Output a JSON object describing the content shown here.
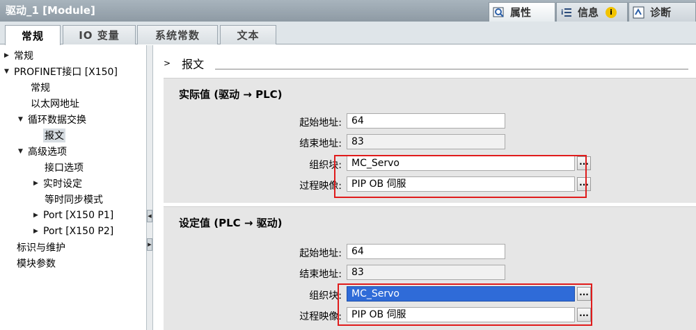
{
  "window": {
    "title": "驱动_1 [Module]"
  },
  "right_tabs": [
    {
      "label": "属性",
      "icon": "properties-icon"
    },
    {
      "label": "信息",
      "icon": "info-icon"
    },
    {
      "label": "诊断",
      "icon": "diagnostics-icon"
    }
  ],
  "tabs": [
    "常规",
    "IO 变量",
    "系统常数",
    "文本"
  ],
  "tree": {
    "items": [
      "常规",
      "PROFINET接口 [X150]",
      "常规",
      "以太网地址",
      "循环数据交换",
      "报文",
      "高级选项",
      "接口选项",
      "实时设定",
      "等时同步模式",
      "Port [X150 P1]",
      "Port [X150 P2]",
      "标识与维护",
      "模块参数"
    ]
  },
  "section": {
    "title": "报文"
  },
  "actual": {
    "title": "实际值 (驱动 → PLC)",
    "start_label": "起始地址:",
    "start_value": "64",
    "end_label": "结束地址:",
    "end_value": "83",
    "ob_label": "组织块:",
    "ob_value": "MC_Servo",
    "pi_label": "过程映像:",
    "pi_value": "PIP OB 伺服"
  },
  "setpoint": {
    "title": "设定值 (PLC → 驱动)",
    "start_label": "起始地址:",
    "start_value": "64",
    "end_label": "结束地址:",
    "end_value": "83",
    "ob_label": "组织块:",
    "ob_value": "MC_Servo",
    "pi_label": "过程映像:",
    "pi_value": "PIP OB 伺服"
  },
  "browse_label": "...",
  "colors": {
    "highlight": "#e01b1b",
    "selection": "#2f6bd8"
  }
}
